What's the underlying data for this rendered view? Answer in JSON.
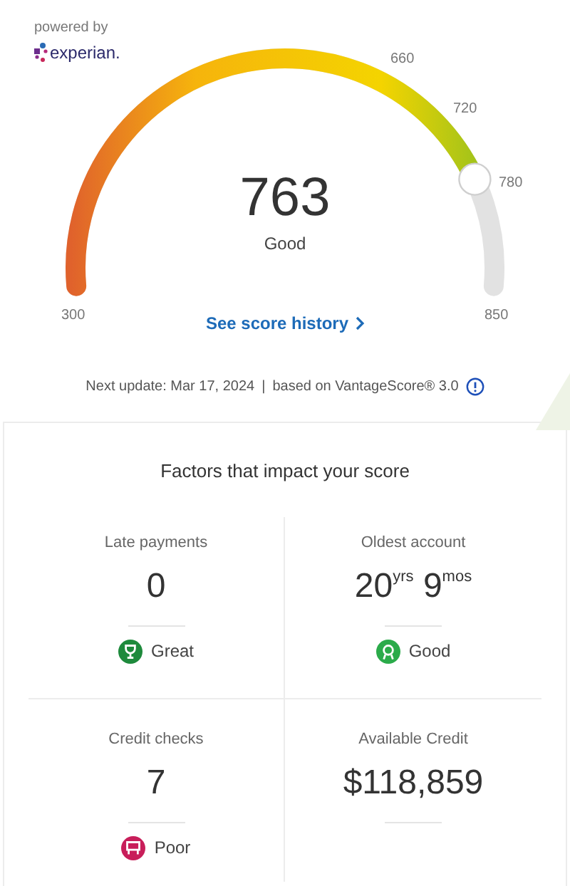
{
  "header": {
    "powered_by": "powered by",
    "brand": "experian."
  },
  "gauge": {
    "score": "763",
    "rating": "Good",
    "ticks": [
      "300",
      "660",
      "720",
      "780",
      "850"
    ]
  },
  "history_link": "See score history",
  "update": {
    "next": "Next update: Mar 17, 2024",
    "separator": "|",
    "model": "based on VantageScore® 3.0"
  },
  "factors": {
    "title": "Factors that impact your score",
    "items": [
      {
        "label": "Late payments",
        "value": "0",
        "rating": "Great",
        "color": "#1e8a3c",
        "kind": "trophy"
      },
      {
        "label": "Oldest account",
        "value": "20$^{yrs}$ 9$^{mos}$",
        "rating": "Good",
        "color": "#2bab4a",
        "kind": "medal"
      },
      {
        "label": "Credit checks",
        "value": "7",
        "rating": "Poor",
        "color": "#c81e5a",
        "kind": "flag"
      },
      {
        "label": "Available Credit",
        "value": "$118,859"
      }
    ]
  }
}
